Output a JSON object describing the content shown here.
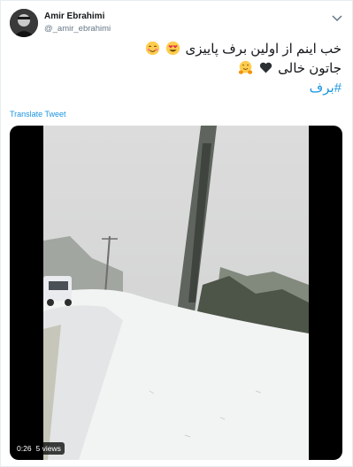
{
  "tweet": {
    "author_name": "Amir Ebrahimi",
    "author_handle": "@_amir_ebrahimi",
    "text_line1": "خب اینم از اولین برف پاییزی",
    "text_line2": "جاتون خالی",
    "hashtag": "#برف",
    "translate_label": "Translate Tweet"
  },
  "icons": {
    "caret": "chevron-down-icon",
    "emoji1": "smiling-face-emoji",
    "emoji2": "heart-eyes-emoji",
    "emoji3": "black-heart-emoji",
    "emoji4": "hugging-face-emoji"
  },
  "video": {
    "time": "0:26",
    "views": "5 views"
  },
  "colors": {
    "link": "#1b95e0",
    "text": "#14171a",
    "secondary": "#657786",
    "border": "#e6ecf0"
  }
}
